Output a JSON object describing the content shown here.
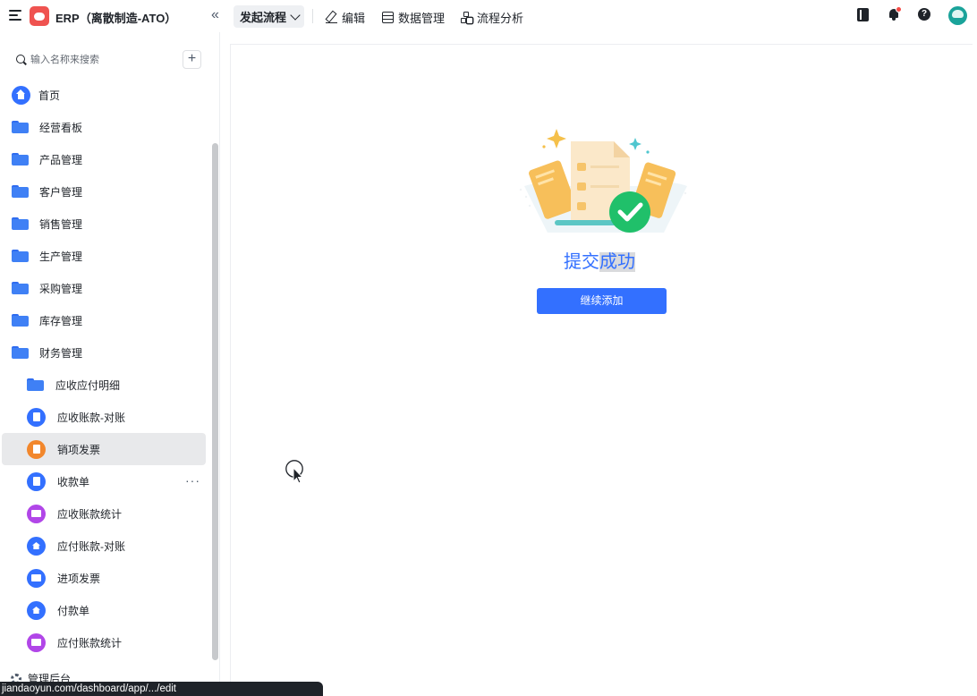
{
  "header": {
    "app_title": "ERP（离散制造-ATO）",
    "collapse_glyph": "«",
    "start_flow_label": "发起流程",
    "edit_label": "编辑",
    "data_manage_label": "数据管理",
    "flow_analysis_label": "流程分析",
    "help_glyph": "?",
    "icons": [
      "menu-icon",
      "app-logo-icon",
      "collapse-icon",
      "chevron-down-icon",
      "edit-icon",
      "table-icon",
      "flow-icon",
      "book-icon",
      "bell-icon",
      "help-icon",
      "avatar"
    ],
    "notification_dot_color": "#f54a45"
  },
  "sidebar": {
    "search_placeholder": "输入名称来搜索",
    "add_glyph": "+",
    "items": [
      {
        "label": "首页",
        "icon": "home-icon"
      },
      {
        "label": "经营看板",
        "icon": "folder-icon"
      },
      {
        "label": "产品管理",
        "icon": "folder-icon"
      },
      {
        "label": "客户管理",
        "icon": "folder-icon"
      },
      {
        "label": "销售管理",
        "icon": "folder-icon"
      },
      {
        "label": "生产管理",
        "icon": "folder-icon"
      },
      {
        "label": "采购管理",
        "icon": "folder-icon"
      },
      {
        "label": "库存管理",
        "icon": "folder-icon"
      },
      {
        "label": "财务管理",
        "icon": "folder-open-icon"
      }
    ],
    "sub_items": [
      {
        "label": "应收应付明细",
        "icon": "folder-icon"
      },
      {
        "label": "应收账款-对账",
        "icon": "document-icon"
      },
      {
        "label": "销项发票",
        "icon": "invoice-icon",
        "active": true
      },
      {
        "label": "收款单",
        "icon": "document-icon"
      },
      {
        "label": "应收账款统计",
        "icon": "chart-icon"
      },
      {
        "label": "应付账款-对账",
        "icon": "house-icon"
      },
      {
        "label": "进项发票",
        "icon": "card-icon"
      },
      {
        "label": "付款单",
        "icon": "house-icon"
      },
      {
        "label": "应付账款统计",
        "icon": "chart-icon"
      }
    ],
    "more_glyph": "···",
    "footer_label": "管理后台"
  },
  "main": {
    "success_text_part1": "提交",
    "success_text_part2": "成功",
    "continue_button": "继续添加"
  },
  "status_bar": {
    "url": "jiandaoyun.com/dashboard/app/.../edit"
  },
  "colors": {
    "accent": "#3370ff",
    "logo_red": "#ef5350",
    "success_green": "#20c06a",
    "active_item_bg": "#e8e9eb"
  }
}
